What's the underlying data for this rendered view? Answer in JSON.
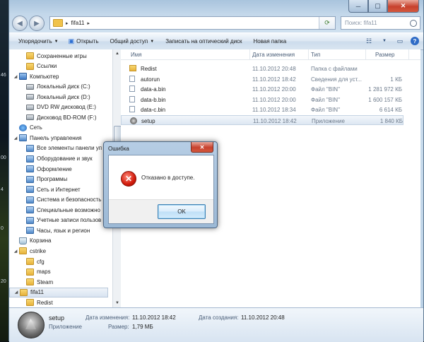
{
  "desktop": {
    "labels": [
      "46",
      "00",
      "4",
      "0",
      "20"
    ]
  },
  "window": {
    "caption": {
      "minimize": "─",
      "maximize": "▢",
      "close": "✕"
    },
    "address": {
      "path": "fifa11",
      "search_placeholder": "Поиск: fifa11"
    },
    "toolbar": {
      "organize": "Упорядочить",
      "open": "Открыть",
      "share": "Общий доступ",
      "burn": "Записать на оптический диск",
      "new_folder": "Новая папка"
    }
  },
  "nav": {
    "items": [
      {
        "label": "Сохраненные игры",
        "icon": "folder",
        "indent": 1
      },
      {
        "label": "Ссылки",
        "icon": "folder",
        "indent": 1
      },
      {
        "label": "Компьютер",
        "icon": "comp",
        "indent": 0,
        "expanded": true
      },
      {
        "label": "Локальный диск (C:)",
        "icon": "drive",
        "indent": 1
      },
      {
        "label": "Локальный диск (D:)",
        "icon": "drive",
        "indent": 1
      },
      {
        "label": "DVD RW дисковод (E:)",
        "icon": "drive",
        "indent": 1
      },
      {
        "label": "Дисковод BD-ROM (F:)",
        "icon": "drive",
        "indent": 1
      },
      {
        "label": "Сеть",
        "icon": "net",
        "indent": 0
      },
      {
        "label": "Панель управления",
        "icon": "cp",
        "indent": 0,
        "expanded": true
      },
      {
        "label": "Все элементы панели уп",
        "icon": "cp",
        "indent": 1
      },
      {
        "label": "Оборудование и звук",
        "icon": "cp",
        "indent": 1
      },
      {
        "label": "Оформление",
        "icon": "cp",
        "indent": 1
      },
      {
        "label": "Программы",
        "icon": "cp",
        "indent": 1
      },
      {
        "label": "Сеть и Интернет",
        "icon": "cp",
        "indent": 1
      },
      {
        "label": "Система и безопасность",
        "icon": "cp",
        "indent": 1
      },
      {
        "label": "Специальные возможно",
        "icon": "cp",
        "indent": 1
      },
      {
        "label": "Учетные записи пользов",
        "icon": "cp",
        "indent": 1
      },
      {
        "label": "Часы, язык и регион",
        "icon": "cp",
        "indent": 1
      },
      {
        "label": "Корзина",
        "icon": "bin",
        "indent": 0
      },
      {
        "label": "cstrike",
        "icon": "folder",
        "indent": 0,
        "expanded": true
      },
      {
        "label": "cfg",
        "icon": "folder",
        "indent": 1
      },
      {
        "label": "maps",
        "icon": "folder",
        "indent": 1
      },
      {
        "label": "Steam",
        "icon": "folder",
        "indent": 1
      },
      {
        "label": "fifa11",
        "icon": "folder",
        "indent": 0,
        "expanded": true,
        "selected": true
      },
      {
        "label": "Redist",
        "icon": "folder",
        "indent": 1
      }
    ]
  },
  "columns": {
    "name": "Имя",
    "date": "Дата изменения",
    "type": "Тип",
    "size": "Размер"
  },
  "files": [
    {
      "name": "Redist",
      "date": "11.10.2012 20:48",
      "type": "Папка с файлами",
      "size": "",
      "icon": "folder"
    },
    {
      "name": "autorun",
      "date": "11.10.2012 18:42",
      "type": "Сведения для уст...",
      "size": "1 КБ",
      "icon": "doc"
    },
    {
      "name": "data-a.bin",
      "date": "11.10.2012 20:00",
      "type": "Файл \"BIN\"",
      "size": "1 281 972 КБ",
      "icon": "doc"
    },
    {
      "name": "data-b.bin",
      "date": "11.10.2012 20:00",
      "type": "Файл \"BIN\"",
      "size": "1 600 157 КБ",
      "icon": "doc"
    },
    {
      "name": "data-c.bin",
      "date": "11.10.2012 18:34",
      "type": "Файл \"BIN\"",
      "size": "6 614 КБ",
      "icon": "doc"
    },
    {
      "name": "setup",
      "date": "11.10.2012 18:42",
      "type": "Приложение",
      "size": "1 840 КБ",
      "icon": "app",
      "selected": true
    }
  ],
  "details": {
    "name": "setup",
    "type": "Приложение",
    "modified_label": "Дата изменения:",
    "modified": "11.10.2012 18:42",
    "size_label": "Размер:",
    "size": "1,79 МБ",
    "created_label": "Дата создания:",
    "created": "11.10.2012 20:48"
  },
  "dialog": {
    "title": "Ошибка",
    "close": "✕",
    "message": "Отказано в доступе.",
    "ok": "OK"
  }
}
